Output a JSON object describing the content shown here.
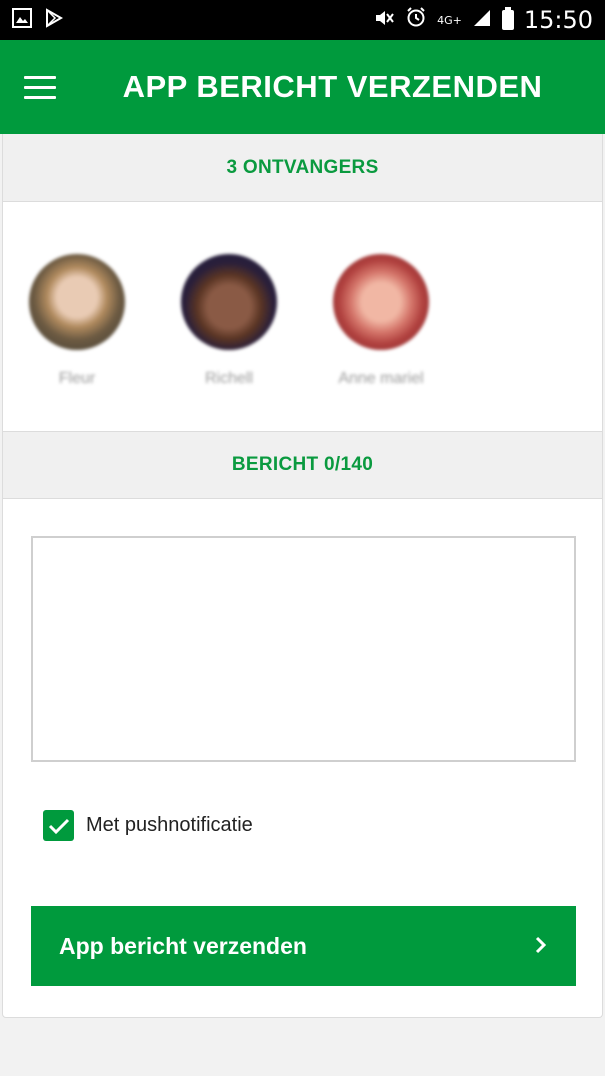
{
  "status_bar": {
    "time": "15:50",
    "network": "4G+",
    "icons": [
      "gallery-icon",
      "play-store-icon",
      "mute-icon",
      "alarm-icon",
      "signal-icon",
      "battery-icon"
    ]
  },
  "app_bar": {
    "title": "APP BERICHT VERZENDEN",
    "menu_icon": "hamburger-menu-icon"
  },
  "recipients_section": {
    "header": "3 ONTVANGERS",
    "recipients": [
      {
        "name": "Fleur"
      },
      {
        "name": "Richell"
      },
      {
        "name": "Anne mariel"
      }
    ]
  },
  "message_section": {
    "header": "BERICHT 0/140",
    "message_value": "",
    "push_notification": {
      "label": "Met pushnotificatie",
      "checked": true
    }
  },
  "send_button": {
    "label": "App bericht verzenden",
    "icon": "chevron-right-icon"
  },
  "colors": {
    "primary_green": "#009a3d",
    "header_text_green": "#0a9a3f",
    "section_bg": "#f0f0f0"
  }
}
